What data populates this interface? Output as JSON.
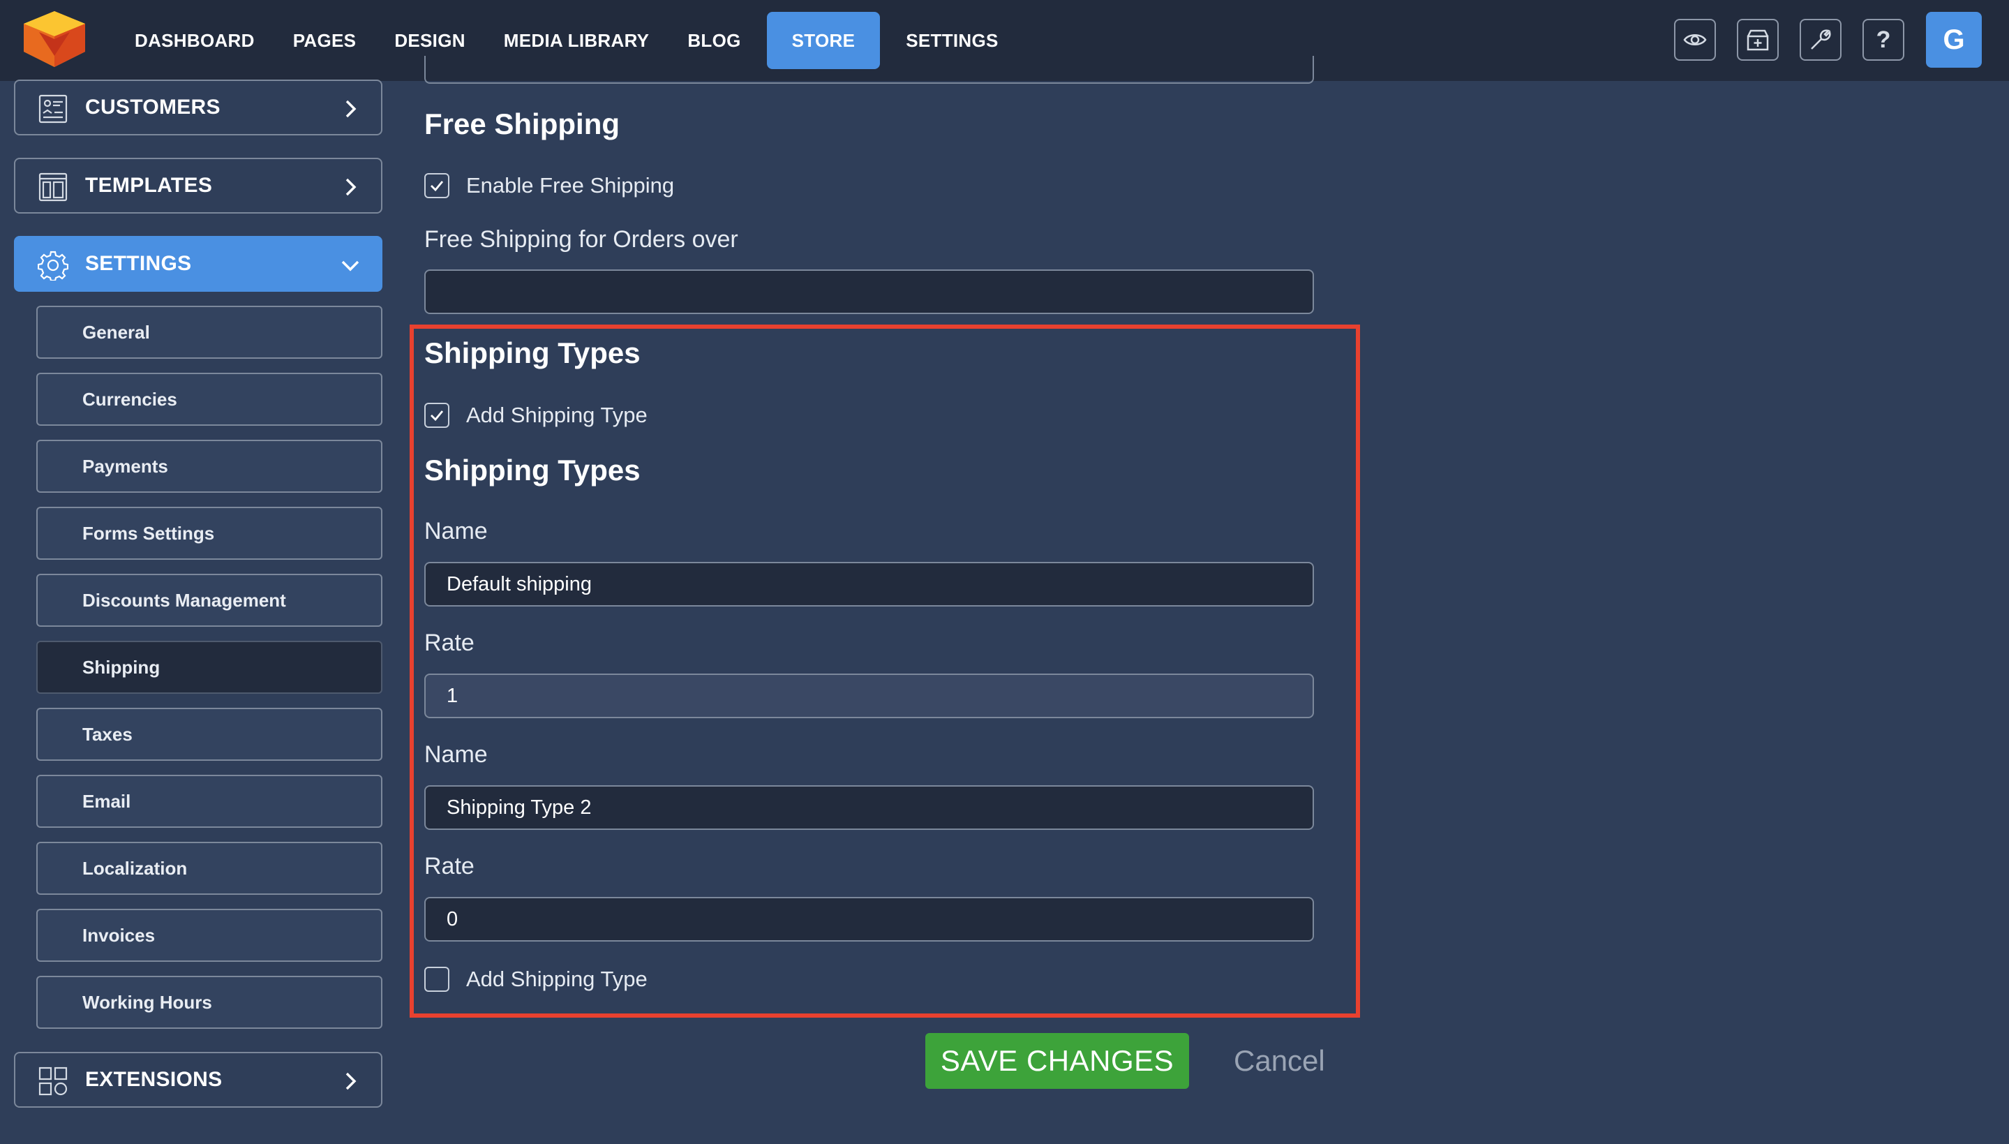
{
  "nav": {
    "items": [
      {
        "label": "DASHBOARD",
        "active": false
      },
      {
        "label": "PAGES",
        "active": false
      },
      {
        "label": "DESIGN",
        "active": false
      },
      {
        "label": "MEDIA LIBRARY",
        "active": false
      },
      {
        "label": "BLOG",
        "active": false
      },
      {
        "label": "STORE",
        "active": true
      },
      {
        "label": "SETTINGS",
        "active": false
      }
    ],
    "tools": [
      {
        "icon": "eye-icon"
      },
      {
        "icon": "store-add-icon"
      },
      {
        "icon": "wrench-icon"
      },
      {
        "icon": "help-icon",
        "glyph": "?"
      }
    ],
    "avatar_letter": "G",
    "accent_color": "#4a90e2"
  },
  "sidebar": {
    "customers_label": "CUSTOMERS",
    "templates_label": "TEMPLATES",
    "settings_label": "SETTINGS",
    "extensions_label": "EXTENSIONS",
    "settings_items": [
      {
        "label": "General",
        "active": false
      },
      {
        "label": "Currencies",
        "active": false
      },
      {
        "label": "Payments",
        "active": false
      },
      {
        "label": "Forms Settings",
        "active": false
      },
      {
        "label": "Discounts Management",
        "active": false
      },
      {
        "label": "Shipping",
        "active": true
      },
      {
        "label": "Taxes",
        "active": false
      },
      {
        "label": "Email",
        "active": false
      },
      {
        "label": "Localization",
        "active": false
      },
      {
        "label": "Invoices",
        "active": false
      },
      {
        "label": "Working Hours",
        "active": false
      }
    ]
  },
  "form": {
    "free_shipping_heading": "Free Shipping",
    "enable_free_shipping_label": "Enable Free Shipping",
    "enable_free_shipping_checked": true,
    "free_shipping_over_label": "Free Shipping for Orders over",
    "free_shipping_over_value": "",
    "shipping_types_heading": "Shipping Types",
    "add_shipping_type_label": "Add Shipping Type",
    "add_shipping_type_checked": true,
    "shipping_types_subheading": "Shipping Types",
    "types": [
      {
        "name_label": "Name",
        "name_value": "Default shipping",
        "rate_label": "Rate",
        "rate_value": "1"
      },
      {
        "name_label": "Name",
        "name_value": "Shipping Type 2",
        "rate_label": "Rate",
        "rate_value": "0"
      }
    ],
    "add_shipping_type_2_label": "Add Shipping Type",
    "add_shipping_type_2_checked": false,
    "highlight_color": "#e8412f"
  },
  "actions": {
    "save_label": "SAVE CHANGES",
    "cancel_label": "Cancel",
    "save_color": "#3da33a"
  }
}
